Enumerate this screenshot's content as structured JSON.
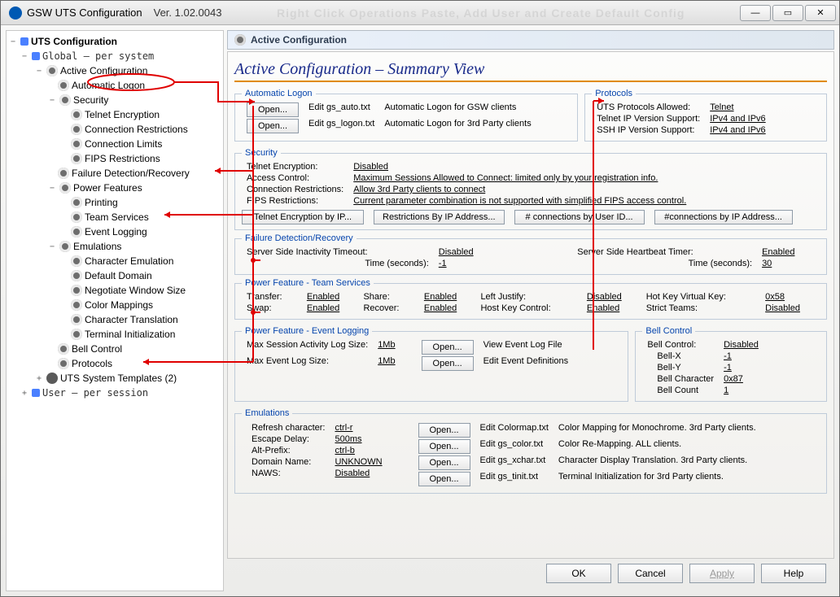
{
  "window": {
    "title": "GSW UTS Configuration",
    "version": "Ver. 1.02.0043",
    "ghost_text": "Right Click Operations Paste, Add User and Create Default Config"
  },
  "tree": {
    "root": "UTS Configuration",
    "global": "Global  – per system",
    "active_config": "Active Configuration",
    "automatic_logon": "Automatic Logon",
    "security": "Security",
    "security_children": [
      "Telnet Encryption",
      "Connection Restrictions",
      "Connection Limits",
      "FIPS Restrictions"
    ],
    "failure_detection": "Failure Detection/Recovery",
    "power_features": "Power Features",
    "power_children": [
      "Printing",
      "Team Services",
      "Event Logging"
    ],
    "emulations": "Emulations",
    "emulation_children": [
      "Character Emulation",
      "Default Domain",
      "Negotiate Window Size",
      "Color Mappings",
      "Character Translation",
      "Terminal Initialization"
    ],
    "bell_control": "Bell Control",
    "protocols": "Protocols",
    "system_templates": "UTS System Templates (2)",
    "user": "User   – per session"
  },
  "header": {
    "title": "Active Configuration"
  },
  "main_title": "Active Configuration – Summary View",
  "groups": {
    "automatic_logon": {
      "legend": "Automatic Logon",
      "btn1": "Open...",
      "btn2": "Open...",
      "lbl1": "Edit gs_auto.txt",
      "lbl2": "Edit gs_logon.txt",
      "desc1": "Automatic Logon for GSW clients",
      "desc2": "Automatic Logon for 3rd Party clients"
    },
    "protocols": {
      "legend": "Protocols",
      "r1_label": "UTS Protocols Allowed:",
      "r1_val": "Telnet",
      "r2_label": "Telnet IP Version Support:",
      "r2_val": "IPv4 and IPv6",
      "r3_label": "SSH IP Version Support:",
      "r3_val": "IPv4 and IPv6"
    },
    "security": {
      "legend": "Security",
      "r1_label": "Telnet Encryption:",
      "r1_val": "Disabled",
      "r2_label": "Access Control:",
      "r2_val": "Maximum Sessions Allowed to Connect: limited only by your registration info.",
      "r3_label": "Connection Restrictions:",
      "r3_val": "Allow 3rd Party clients to connect",
      "r4_label": "FIPS Restrictions:",
      "r4_val": "Current parameter combination is not supported with simplified FIPS access control.",
      "b1": "Telnet Encryption by IP...",
      "b2": "Restrictions By IP Address...",
      "b3": "# connections by User ID...",
      "b4": "#connections by IP Address..."
    },
    "failure": {
      "legend": "Failure Detection/Recovery",
      "l1": "Server Side Inactivity Timeout:",
      "v1": "Disabled",
      "l2": "Time (seconds):",
      "v2": "-1",
      "l3": "Server Side Heartbeat Timer:",
      "v3": "Enabled",
      "l4": "Time (seconds):",
      "v4": "30"
    },
    "teams": {
      "legend": "Power Feature - Team Services",
      "transfer_l": "Transfer:",
      "transfer_v": "Enabled",
      "share_l": "Share:",
      "share_v": "Enabled",
      "left_l": "Left Justify:",
      "left_v": "Disabled",
      "hot_l": "Hot Key Virtual Key:",
      "hot_v": "0x58",
      "swap_l": "Swap:",
      "swap_v": "Enabled",
      "recover_l": "Recover:",
      "recover_v": "Enabled",
      "host_l": "Host Key Control:",
      "host_v": "Enabled",
      "strict_l": "Strict Teams:",
      "strict_v": "Disabled"
    },
    "eventlog": {
      "legend": "Power Feature - Event Logging",
      "l1": "Max Session Activity Log Size:",
      "v1": "1Mb",
      "l2": "Max Event Log Size:",
      "v2": "1Mb",
      "open1": "Open...",
      "open2": "Open...",
      "d1": "View Event Log File",
      "d2": "Edit Event Definitions"
    },
    "bell": {
      "legend": "Bell Control",
      "r1_l": "Bell Control:",
      "r1_v": "Disabled",
      "r2_l": "Bell-X",
      "r2_v": "-1",
      "r3_l": "Bell-Y",
      "r3_v": "-1",
      "r4_l": "Bell Character",
      "r4_v": "0x87",
      "r5_l": "Bell Count",
      "r5_v": "1"
    },
    "emulations": {
      "legend": "Emulations",
      "rows": [
        {
          "l": "Refresh character:",
          "v": "ctrl-r"
        },
        {
          "l": "Escape Delay:",
          "v": "500ms"
        },
        {
          "l": "Alt-Prefix:",
          "v": "ctrl-b"
        },
        {
          "l": "Domain Name:",
          "v": "UNKNOWN"
        },
        {
          "l": "NAWS:",
          "v": "Disabled"
        }
      ],
      "btn": "Open...",
      "files": [
        "Edit Colormap.txt",
        "Edit gs_color.txt",
        "Edit gs_xchar.txt",
        "Edit gs_tinit.txt"
      ],
      "descs": [
        "Color Mapping for Monochrome. 3rd Party clients.",
        "Color Re-Mapping. ALL clients.",
        "Character Display Translation. 3rd Party clients.",
        "Terminal Initialization for 3rd Party clients."
      ]
    }
  },
  "dialog_buttons": {
    "ok": "OK",
    "cancel": "Cancel",
    "apply": "Apply",
    "help": "Help"
  }
}
